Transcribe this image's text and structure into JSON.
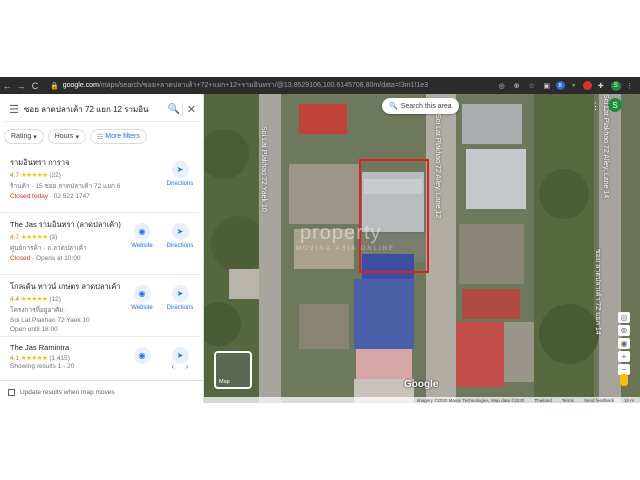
{
  "browser": {
    "url_host": "google.com",
    "url_path": "/maps/search/ซอย+ลาดปลาเค้า+72+แยก+12+รามอินทรา/@13.8529106,100.6145706,80m/data=!3m1!1e3",
    "nav": {
      "back": "←",
      "forward": "→",
      "reload": "C"
    },
    "lock": "🔒",
    "profile_initial": "S"
  },
  "search": {
    "menu_icon": "☰",
    "query": "ซอย ลาดปลาเค้า 72 แยก 12 รามอิน",
    "search_icon": "🔍",
    "close_icon": "✕"
  },
  "filters": [
    {
      "label": "Rating",
      "caret": "▾"
    },
    {
      "label": "Hours",
      "caret": "▾"
    },
    {
      "label": "More filters",
      "icon": "☷"
    }
  ],
  "results": [
    {
      "name": "รามอินทรา การาจ",
      "rating": "4.7",
      "stars": "★★★★★",
      "reviews": "(22)",
      "line1": "ร้านค้า · 15 ซอย ลาดปลาเค้า 72 แยก 6",
      "status_prefix": "Closed today",
      "status_suffix": " · 02 522 1747",
      "actions": [
        {
          "label": "Directions",
          "icon": "➤"
        }
      ]
    },
    {
      "name": "The Jas รามอินทรา (ลาดปลาเค้า)",
      "rating": "4.7",
      "stars": "★★★★★",
      "reviews": "(3)",
      "line1": "ศูนย์การค้า · ถ.ลาดปลาเค้า",
      "status_prefix": "Closed",
      "status_suffix": " · Opens at 10:00",
      "actions": [
        {
          "label": "Website",
          "icon": "◉"
        },
        {
          "label": "Directions",
          "icon": "➤"
        }
      ]
    },
    {
      "name": "โกลเด้น ทาวน์ เกษตร ลาดปลาเค้า",
      "rating": "4.4",
      "stars": "★★★★★",
      "reviews": "(12)",
      "line1": "โครงการที่อยู่อาศัย ·",
      "line2": "Soi Lat Plakhao 72 Yaek 10",
      "status_prefix": "",
      "status_suffix": "Open until 18:00",
      "actions": [
        {
          "label": "Website",
          "icon": "◉"
        },
        {
          "label": "Directions",
          "icon": "➤"
        }
      ]
    },
    {
      "name": "The Jas Ramintra",
      "rating": "4.1",
      "stars": "★★★★★",
      "reviews": "(1,415)",
      "line1": "",
      "status_prefix": "",
      "status_suffix": "",
      "actions": [
        {
          "label": "",
          "icon": "◉"
        },
        {
          "label": "",
          "icon": "➤"
        }
      ]
    }
  ],
  "pager": {
    "text": "Showing results 1 - 20",
    "prev": "‹",
    "next": "›"
  },
  "update_label": "Update results when map moves",
  "collapse_icon": "◂",
  "map": {
    "search_area": "Search this area",
    "search_area_icon": "🔍",
    "apps_icon": "⋮⋮",
    "profile_initial": "S",
    "road_labels": [
      "Soi Lat Plakhao 72 Yaek 10",
      "Soi Lat Plakhao 72 Alley, Lane 12",
      "Soi Lat Plakhao 72 Alley, Lane 14",
      "ซอย ลาดปลาเค้า 72 แยก 14"
    ],
    "watermark": "property",
    "watermark_sub": "MOVING ASIA ONLINE",
    "logo": "Google",
    "layer_label": "Map",
    "footer": [
      "Imagery ©2020 Maxar Technologies, Map data ©2020",
      "Thailand",
      "Terms",
      "Send feedback",
      "10 m"
    ],
    "zoom_in": "+",
    "zoom_out": "−",
    "highlight_color": "#e02020"
  }
}
